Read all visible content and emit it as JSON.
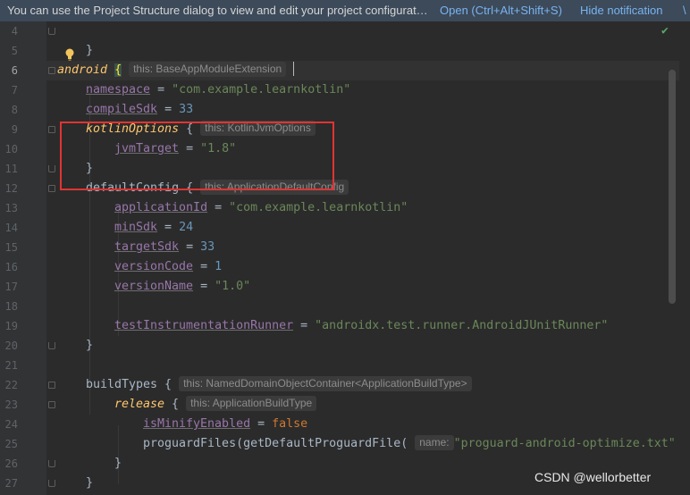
{
  "banner": {
    "message": "You can use the Project Structure dialog to view and edit your project configurat…",
    "open_link": "Open (Ctrl+Alt+Shift+S)",
    "hide_link": "Hide notification"
  },
  "editor": {
    "line_numbers": [
      "4",
      "5",
      "6",
      "7",
      "8",
      "9",
      "10",
      "11",
      "12",
      "13",
      "14",
      "15",
      "16",
      "17",
      "18",
      "19",
      "20",
      "21",
      "22",
      "23",
      "24",
      "25",
      "26",
      "27"
    ],
    "current_line": "6",
    "code": {
      "l4_brace": "}",
      "l6_android": "android",
      "l6_brace": "{",
      "l6_hint": "this: BaseAppModuleExtension",
      "l7_prop": "namespace",
      "l7_eq": " = ",
      "l7_val": "\"com.example.learnkotlin\"",
      "l8_prop": "compileSdk",
      "l8_eq": " = ",
      "l8_val": "33",
      "l9_fn": "kotlinOptions",
      "l9_brace": " { ",
      "l9_hint": "this: KotlinJvmOptions",
      "l10_prop": "jvmTarget",
      "l10_eq": " = ",
      "l10_val": "\"1.8\"",
      "l11_brace": "}",
      "l12_text": "defaultConfig { ",
      "l12_hint": "this: ApplicationDefaultConfig",
      "l13_prop": "applicationId",
      "l13_eq": " = ",
      "l13_val": "\"com.example.learnkotlin\"",
      "l14_prop": "minSdk",
      "l14_eq": " = ",
      "l14_val": "24",
      "l15_prop": "targetSdk",
      "l15_eq": " = ",
      "l15_val": "33",
      "l16_prop": "versionCode",
      "l16_eq": " = ",
      "l16_val": "1",
      "l17_prop": "versionName",
      "l17_eq": " = ",
      "l17_val": "\"1.0\"",
      "l19_prop": "testInstrumentationRunner",
      "l19_eq": " = ",
      "l19_val": "\"androidx.test.runner.AndroidJUnitRunner\"",
      "l20_brace": "}",
      "l22_text": "buildTypes { ",
      "l22_hint": "this: NamedDomainObjectContainer<ApplicationBuildType>",
      "l23_kw": "release",
      "l23_brace": " { ",
      "l23_hint": "this: ApplicationBuildType",
      "l24_prop": "isMinifyEnabled",
      "l24_eq": " = ",
      "l24_val": "false",
      "l25_text": "proguardFiles(getDefaultProguardFile( ",
      "l25_hint": "name:",
      "l25_val": "\"proguard-android-optimize.txt\"",
      "l26_brace": "}",
      "l27_brace": "}"
    }
  },
  "colors": {
    "highlight_box": "#e03434",
    "editor_bg": "#2b2b2b",
    "banner_bg": "#3c4a5a"
  },
  "watermark": "CSDN @wellorbetter"
}
